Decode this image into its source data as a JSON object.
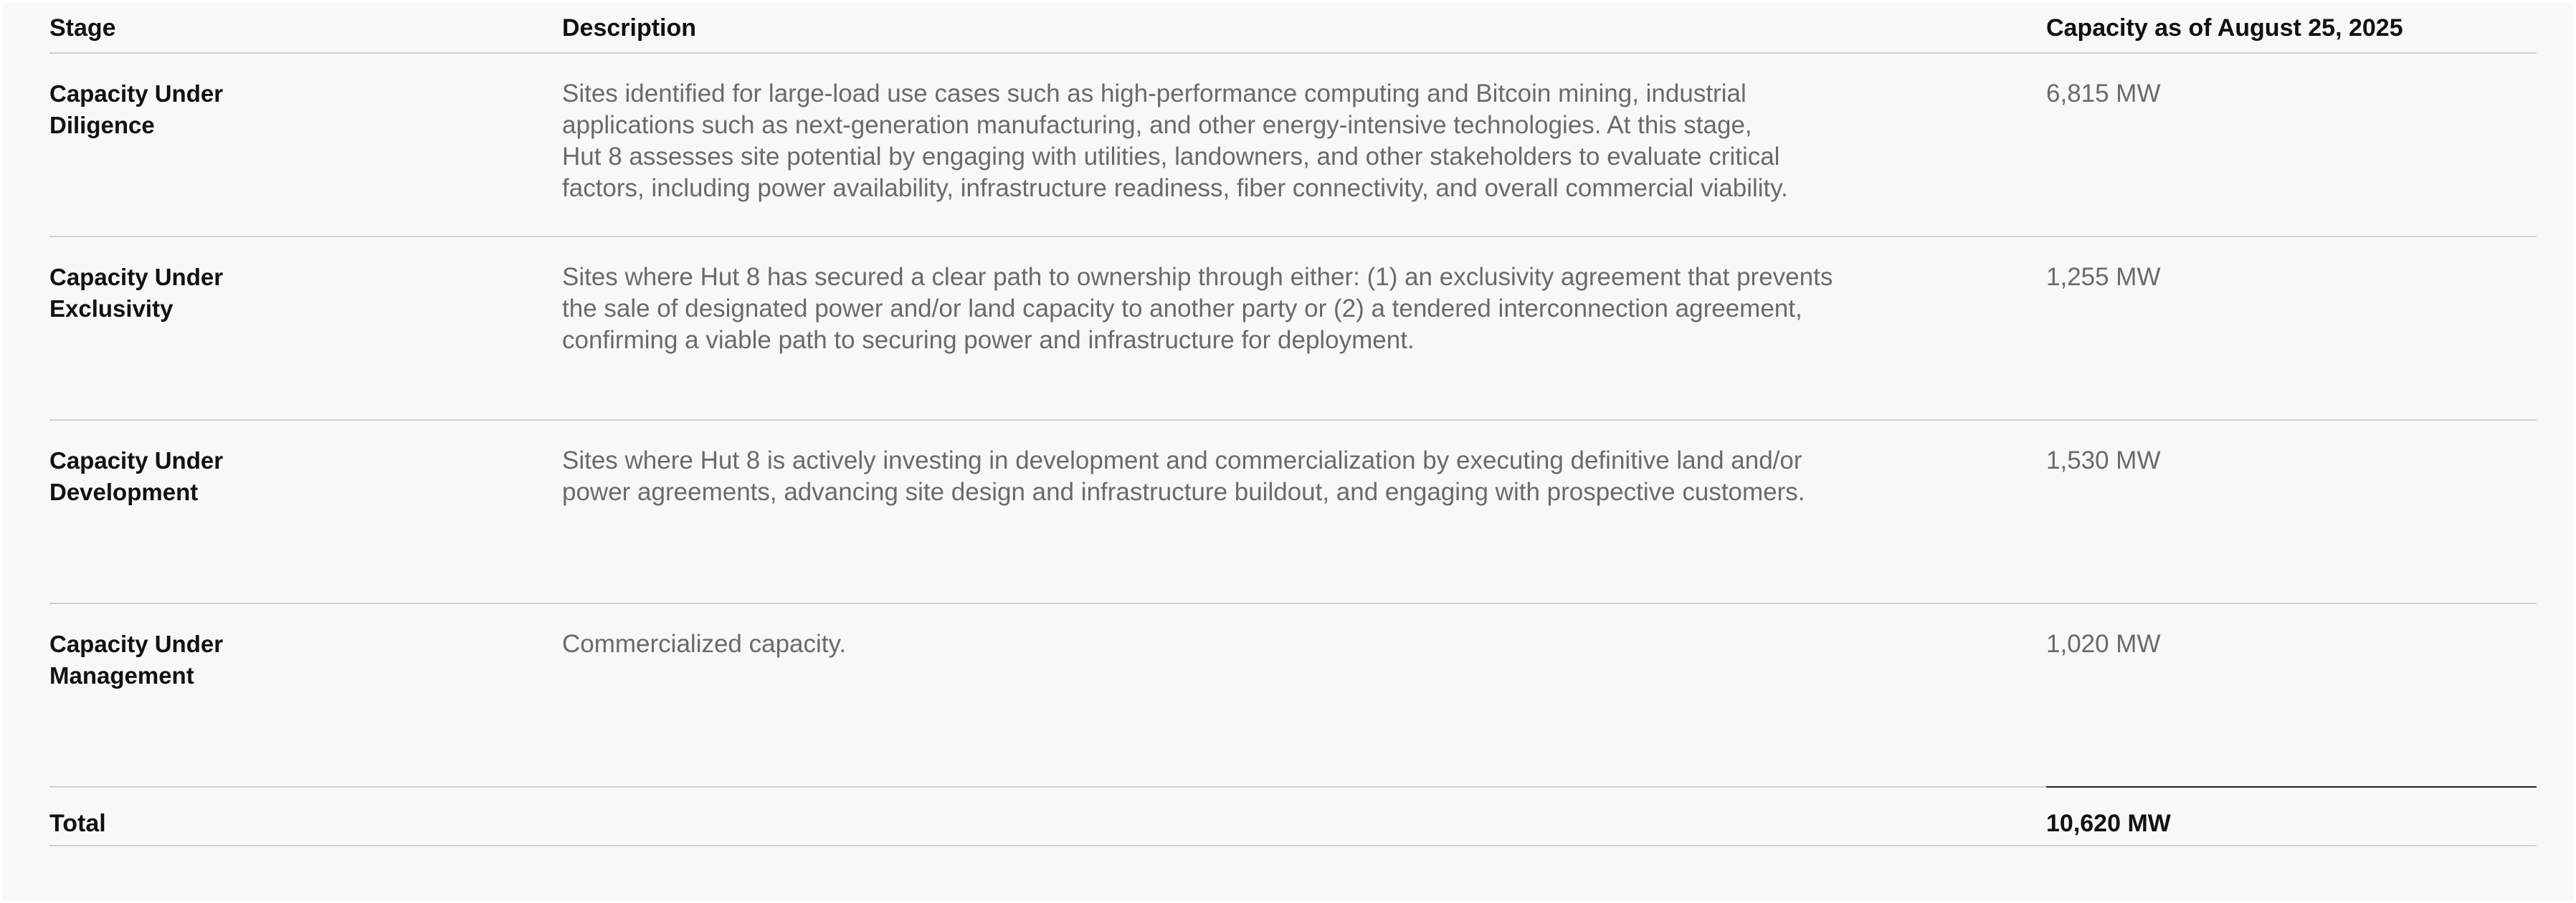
{
  "header": {
    "stage": "Stage",
    "description": "Description",
    "capacity": "Capacity as of August 25, 2025"
  },
  "rows": [
    {
      "stage": "Capacity Under\nDiligence",
      "description": "Sites identified for large-load use cases such as high-performance computing and Bitcoin mining, industrial\napplications such as next-generation manufacturing, and other energy-intensive technologies. At this stage,\nHut 8 assesses site potential by engaging with utilities, landowners, and other stakeholders to evaluate critical\nfactors, including power availability, infrastructure readiness, fiber connectivity, and overall commercial viability.",
      "capacity": "6,815 MW"
    },
    {
      "stage": "Capacity Under\nExclusivity",
      "description": "Sites where Hut 8 has secured a clear path to ownership through either: (1) an exclusivity agreement that prevents\nthe sale of designated power and/or land capacity to another party or (2) a tendered interconnection agreement,\nconfirming a viable path to securing power and infrastructure for deployment.",
      "capacity": "1,255 MW"
    },
    {
      "stage": "Capacity Under\nDevelopment",
      "description": "Sites where Hut 8 is actively investing in development and commercialization by executing definitive land and/or\npower agreements, advancing site design and infrastructure buildout, and engaging with prospective customers.",
      "capacity": "1,530 MW"
    },
    {
      "stage": "Capacity Under\nManagement",
      "description": "Commercialized capacity.",
      "capacity": "1,020 MW"
    }
  ],
  "total": {
    "label": "Total",
    "capacity": "10,620 MW"
  }
}
